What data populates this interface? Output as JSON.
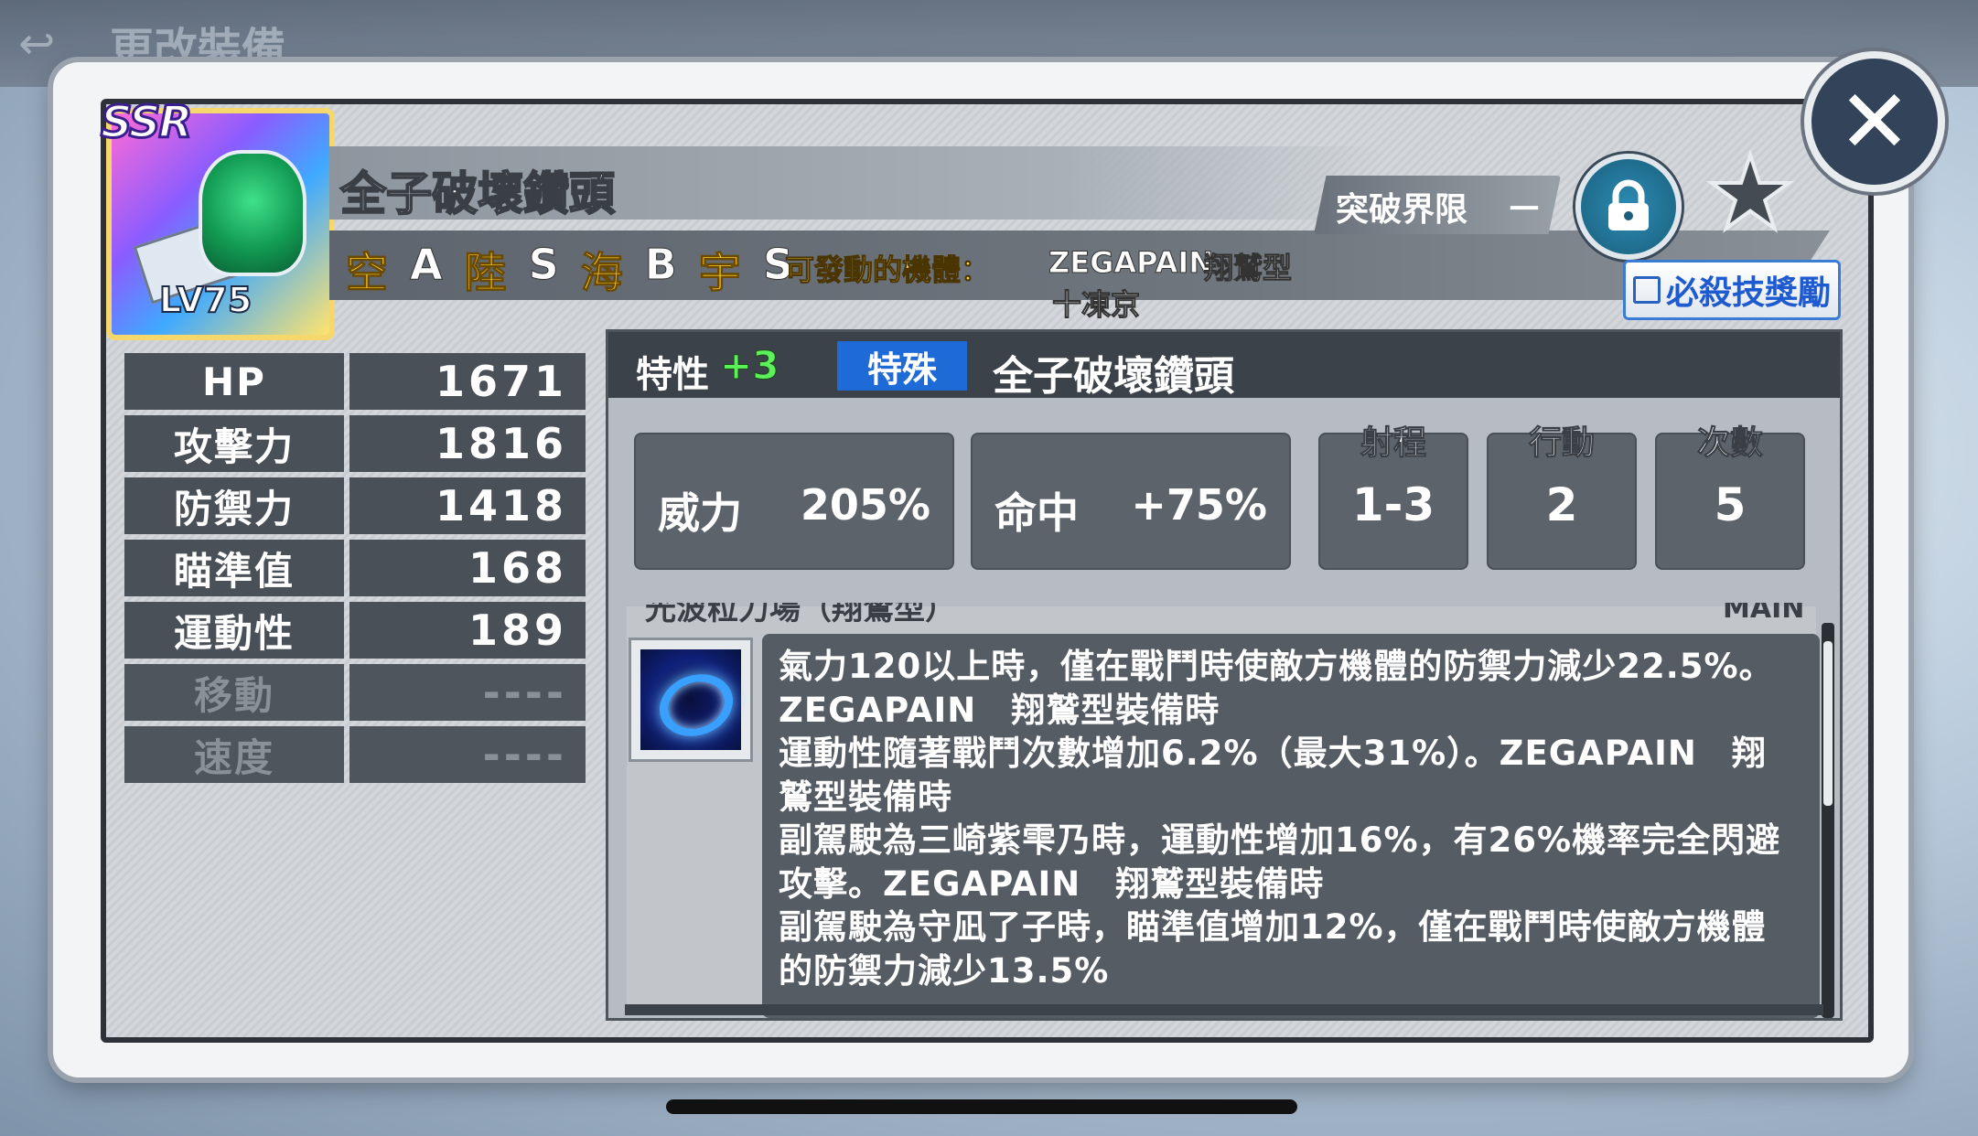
{
  "background": {
    "title": "更改裝備",
    "back_icon": "back-arrow-icon"
  },
  "card": {
    "rarity": "SSR",
    "level": "LV75",
    "name": "全子破壞鑽頭",
    "terrain": [
      {
        "key": "空",
        "value": "A"
      },
      {
        "key": "陸",
        "value": "S"
      },
      {
        "key": "海",
        "value": "B"
      },
      {
        "key": "宇",
        "value": "S"
      }
    ],
    "available_label": "可發動的機體：",
    "available_units": [
      "ZEGAPAIN",
      "翔鷲型",
      "十凍京"
    ],
    "limit_break_label": "突破界限",
    "limit_break_value": "－",
    "ultimate_button": "必殺技獎勵"
  },
  "stats": [
    {
      "label": "HP",
      "value": "1671",
      "dim": false
    },
    {
      "label": "攻擊力",
      "value": "1816",
      "dim": false
    },
    {
      "label": "防禦力",
      "value": "1418",
      "dim": false
    },
    {
      "label": "瞄準值",
      "value": "168",
      "dim": false
    },
    {
      "label": "運動性",
      "value": "189",
      "dim": false
    },
    {
      "label": "移動",
      "value": "----",
      "dim": true
    },
    {
      "label": "速度",
      "value": "----",
      "dim": true
    }
  ],
  "skill": {
    "trait_label": "特性",
    "trait_plus": "+3",
    "type_tag": "特殊",
    "name": "全子破壞鑽頭",
    "power_label": "威力",
    "power_value": "205%",
    "hit_label": "命中",
    "hit_value": "+75%",
    "range_label": "射程",
    "range_value": "1-3",
    "action_label": "行動",
    "action_value": "2",
    "count_label": "次數",
    "count_value": "5",
    "ability_title_partial": "光波粒力場（翔鷲型）",
    "ability_tag_partial": "MAIN",
    "description": "氣力120以上時，僅在戰鬥時使敵方機體的防禦力減少22.5%。\nZEGAPAIN　翔鷲型裝備時\n運動性隨著戰鬥次數增加6.2%（最大31%）。ZEGAPAIN　翔\n鷲型裝備時\n副駕駛為三崎紫雫乃時，運動性增加16%，有26%機率完全閃避\n攻擊。ZEGAPAIN　翔鷲型裝備時\n副駕駛為守凪了子時，瞄準值增加12%，僅在戰鬥時使敵方機體\n的防禦力減少13.5%"
  },
  "icons": {
    "close": "close-icon",
    "lock": "lock-icon",
    "favorite": "star-icon",
    "ability": "ring-icon"
  }
}
